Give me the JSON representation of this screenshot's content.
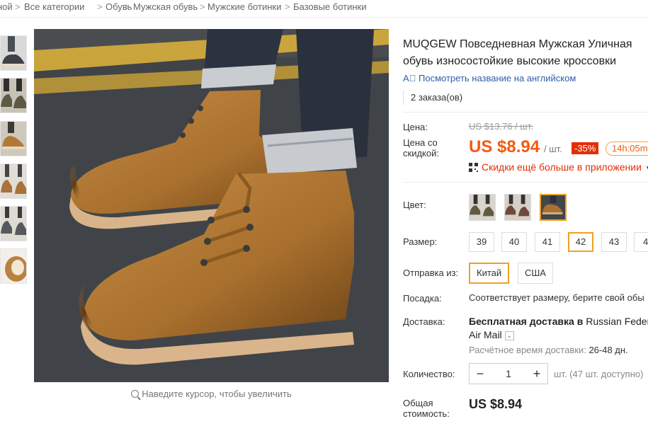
{
  "breadcrumb": {
    "items": [
      "ной",
      "Все категории",
      "Обувь",
      "Мужская обувь",
      "Мужские ботинки",
      "Базовые ботинки"
    ],
    "separator": ">"
  },
  "gallery": {
    "zoom_hint": "Наведите курсор, чтобы увеличить"
  },
  "product": {
    "title": "MUQGEW Повседневная Мужская Уличная обувь износостойкие высокие кроссовки",
    "translate_link": "Посмотреть название на английском",
    "orders": "2 заказа(ов)"
  },
  "price": {
    "label": "Цена:",
    "old": "US $13.76 / шт.",
    "discount_label": "Цена со скидкой:",
    "current": "US $8.94",
    "unit": "/ шт.",
    "discount_badge": "-35%",
    "timer": "14h:05m",
    "app_deal": "Скидки ещё больше в приложении"
  },
  "options": {
    "color_label": "Цвет:",
    "size_label": "Размер:",
    "sizes": [
      "39",
      "40",
      "41",
      "42",
      "43",
      "4"
    ],
    "selected_size": "42",
    "ship_from_label": "Отправка из:",
    "ship_from": [
      "Китай",
      "США"
    ],
    "selected_ship_from": "Китай"
  },
  "fit": {
    "label": "Посадка:",
    "value": "Соответствует размеру, берите свой обы"
  },
  "delivery": {
    "label": "Доставка:",
    "free": "Бесплатная доставка в",
    "country": "Russian Federa",
    "carrier": "Air Mail",
    "estimate_label": "Расчётное время доставки:",
    "estimate_value": "26-48 дн."
  },
  "quantity": {
    "label": "Количество:",
    "minus": "−",
    "value": "1",
    "plus": "+",
    "available": "шт. (47 шт. доступно)"
  },
  "total": {
    "label": "Общая стоимость:",
    "value": "US $8.94"
  },
  "colors": {
    "accent": "#f25a0f",
    "selected_border": "#f0a020",
    "link": "#2d5ea8",
    "badge": "#e62e04"
  }
}
